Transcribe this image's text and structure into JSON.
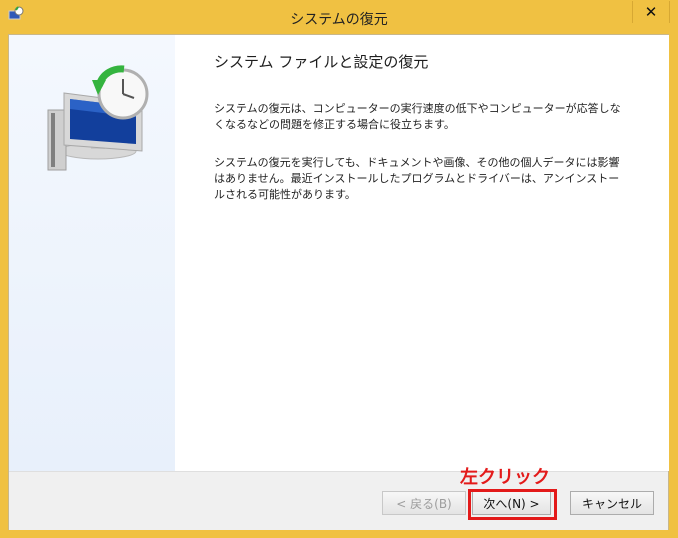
{
  "window": {
    "title": "システムの復元",
    "close_symbol": "✕"
  },
  "icons": {
    "title_icon": "restore-icon",
    "art_icon": "computer-clock-icon"
  },
  "content": {
    "heading": "システム ファイルと設定の復元",
    "paragraph1": "システムの復元は、コンピューターの実行速度の低下やコンピューターが応答しなくなるなどの問題を修正する場合に役立ちます。",
    "paragraph2": "システムの復元を実行しても、ドキュメントや画像、その他の個人データには影響はありません。最近インストールしたプログラムとドライバーは、アンインストールされる可能性があります。"
  },
  "buttons": {
    "back_label": "< 戻る(B)",
    "next_label": "次へ(N) >",
    "cancel_label": "キャンセル"
  },
  "annotation": {
    "text": "左クリック",
    "color": "#e31a1a"
  },
  "colors": {
    "titlebar": "#f0c142",
    "highlight": "#e31a1a"
  }
}
